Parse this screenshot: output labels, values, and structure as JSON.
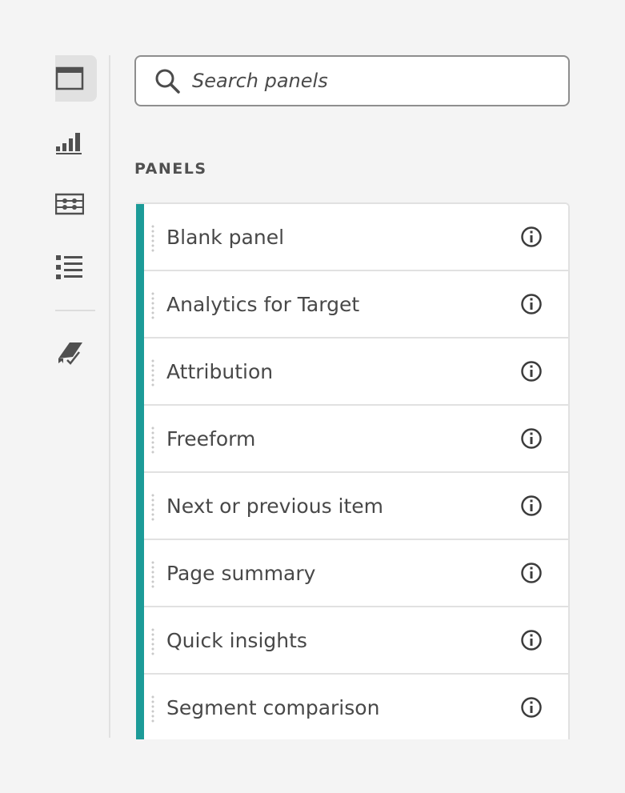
{
  "rail": {
    "items": [
      {
        "icon": "panel-icon",
        "active": true
      },
      {
        "icon": "bar-chart-icon",
        "active": false
      },
      {
        "icon": "segments-icon",
        "active": false
      },
      {
        "icon": "list-icon",
        "active": false
      },
      {
        "icon": "curated-components-icon",
        "active": false
      }
    ]
  },
  "search": {
    "placeholder": "Search panels",
    "value": ""
  },
  "section": {
    "heading": "PANELS"
  },
  "panels": [
    {
      "label": "Blank panel"
    },
    {
      "label": "Analytics for Target"
    },
    {
      "label": "Attribution"
    },
    {
      "label": "Freeform"
    },
    {
      "label": "Next or previous item"
    },
    {
      "label": "Page summary"
    },
    {
      "label": "Quick insights"
    },
    {
      "label": "Segment comparison"
    }
  ],
  "colors": {
    "accent": "#1c9b98",
    "icon": "#505050"
  }
}
